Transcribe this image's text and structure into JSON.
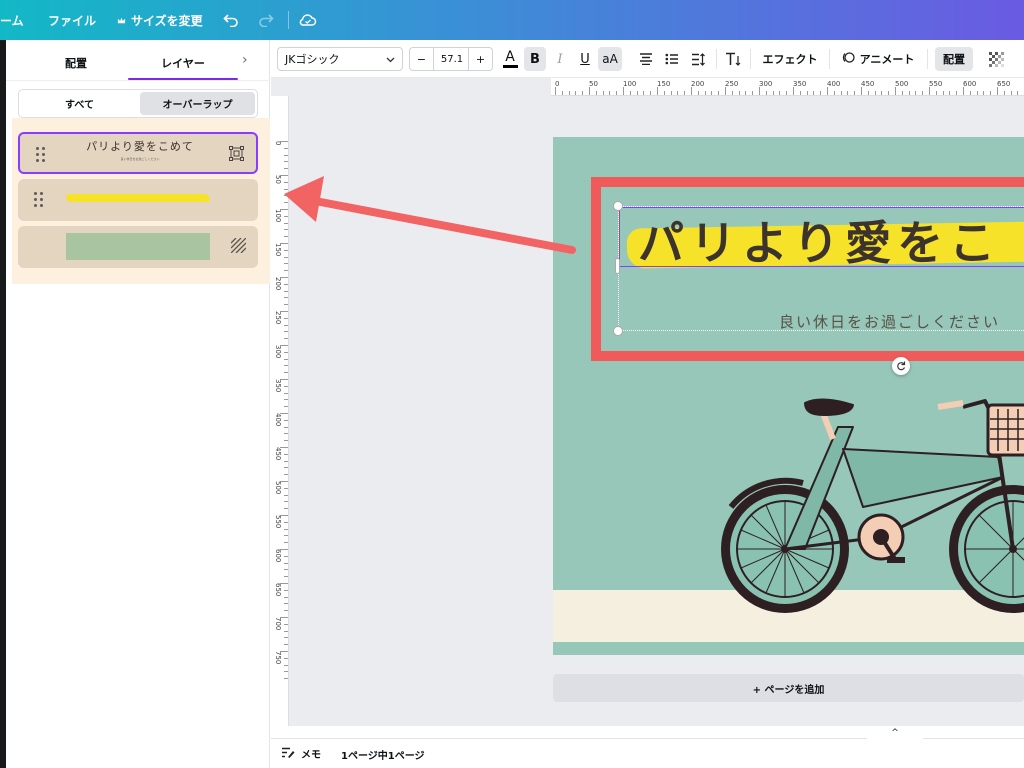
{
  "topbar": {
    "home_label": "ーム",
    "file_label": "ファイル",
    "resize_label": "サイズを変更",
    "undo_icon": "undo-icon",
    "redo_icon": "redo-icon",
    "cloud_icon": "cloud-sync-icon"
  },
  "panel": {
    "tab_position": "配置",
    "tab_layers": "レイヤー",
    "chevron": "›",
    "filter_all": "すべて",
    "filter_overlap": "オーバーラップ",
    "layers": [
      {
        "title": "パリより愛をこめて",
        "subtitle": "良い休日をお過ごしください",
        "kind": "text",
        "selected": true
      },
      {
        "title": "",
        "kind": "yellow-brush",
        "selected": false
      },
      {
        "title": "",
        "kind": "green-shape",
        "selected": false
      }
    ]
  },
  "toolbar": {
    "font_name": "JKゴシック",
    "minus": "−",
    "font_size": "57.1",
    "plus": "+",
    "text_color_label": "A",
    "bold_label": "B",
    "italic_label": "I",
    "underline_label": "U",
    "case_label": "aA",
    "effects_label": "エフェクト",
    "animate_label": "アニメート",
    "position_label": "配置"
  },
  "ruler_h": [
    "0",
    "50",
    "100",
    "150",
    "200",
    "250",
    "300",
    "350",
    "400",
    "450",
    "500",
    "550",
    "600",
    "650"
  ],
  "ruler_v": [
    "0",
    "50",
    "100",
    "150",
    "200",
    "250",
    "300",
    "350",
    "400",
    "450",
    "500",
    "550",
    "600",
    "650",
    "700",
    "750"
  ],
  "canvas": {
    "heading": "パリより愛をこ",
    "subheading": "良い休日をお過ごしください",
    "colors": {
      "background": "#96c7b8",
      "frame": "#f05a5a",
      "highlight": "#f7e22a",
      "ground": "#f4efdf"
    }
  },
  "add_page_label": "+ ページを追加",
  "bottombar": {
    "notes_label": "メモ",
    "page_info": "1ページ中1ページ",
    "expand_icon": "^"
  }
}
